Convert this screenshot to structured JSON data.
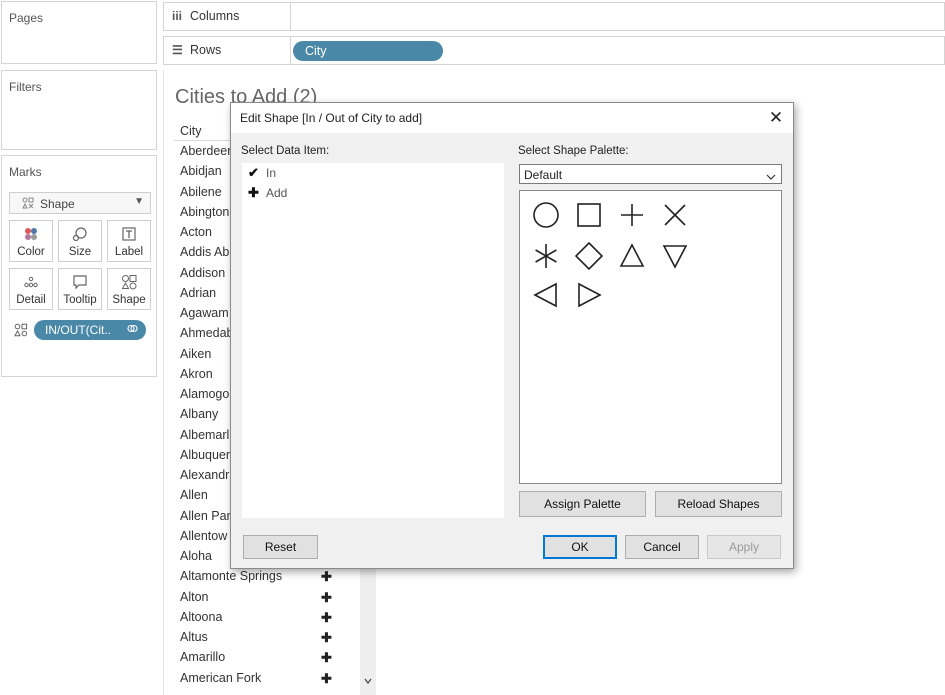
{
  "panes": {
    "pages_title": "Pages",
    "filters_title": "Filters",
    "marks_title": "Marks"
  },
  "marks": {
    "type_label": "Shape",
    "buttons": [
      {
        "label": "Color",
        "icon": "color-dots-icon"
      },
      {
        "label": "Size",
        "icon": "size-icon"
      },
      {
        "label": "Label",
        "icon": "label-icon"
      },
      {
        "label": "Detail",
        "icon": "detail-icon"
      },
      {
        "label": "Tooltip",
        "icon": "tooltip-icon"
      },
      {
        "label": "Shape",
        "icon": "shape-icon"
      }
    ],
    "shape_pill": "IN/OUT(Cit.."
  },
  "shelves": {
    "columns_label": "Columns",
    "rows_label": "Rows",
    "rows_pill": "City"
  },
  "sheet": {
    "title": "Cities to Add (2)",
    "column_header": "City",
    "cities": [
      {
        "name": "Aberdeen",
        "mark": ""
      },
      {
        "name": "Abidjan",
        "mark": ""
      },
      {
        "name": "Abilene",
        "mark": ""
      },
      {
        "name": "Abington",
        "mark": ""
      },
      {
        "name": "Acton",
        "mark": ""
      },
      {
        "name": "Addis Ab",
        "mark": ""
      },
      {
        "name": "Addison",
        "mark": ""
      },
      {
        "name": "Adrian",
        "mark": ""
      },
      {
        "name": "Agawam",
        "mark": ""
      },
      {
        "name": "Ahmedab",
        "mark": ""
      },
      {
        "name": "Aiken",
        "mark": ""
      },
      {
        "name": "Akron",
        "mark": ""
      },
      {
        "name": "Alamogo",
        "mark": ""
      },
      {
        "name": "Albany",
        "mark": ""
      },
      {
        "name": "Albemarl",
        "mark": ""
      },
      {
        "name": "Albuquer",
        "mark": ""
      },
      {
        "name": "Alexandr",
        "mark": ""
      },
      {
        "name": "Allen",
        "mark": ""
      },
      {
        "name": "Allen Par",
        "mark": ""
      },
      {
        "name": "Allentow",
        "mark": ""
      },
      {
        "name": "Aloha",
        "mark": ""
      },
      {
        "name": "Altamonte Springs",
        "mark": "✚"
      },
      {
        "name": "Alton",
        "mark": "✚"
      },
      {
        "name": "Altoona",
        "mark": "✚"
      },
      {
        "name": "Altus",
        "mark": "✚"
      },
      {
        "name": "Amarillo",
        "mark": "✚"
      },
      {
        "name": "American Fork",
        "mark": "✚"
      }
    ]
  },
  "dialog": {
    "title": "Edit Shape [In / Out of City to add]",
    "select_data_item_label": "Select Data Item:",
    "data_items": [
      {
        "label": "In",
        "mark": "✔"
      },
      {
        "label": "Add",
        "mark": "✚"
      }
    ],
    "select_palette_label": "Select Shape Palette:",
    "palette_value": "Default",
    "shapes": [
      "circle-shape",
      "square-shape",
      "plus-shape",
      "cross-shape",
      "asterisk-shape",
      "diamond-shape",
      "triangle-up-shape",
      "triangle-down-shape",
      "triangle-left-shape",
      "triangle-right-shape"
    ],
    "assign_label": "Assign Palette",
    "reload_label": "Reload Shapes",
    "reset_label": "Reset",
    "ok_label": "OK",
    "cancel_label": "Cancel",
    "apply_label": "Apply"
  },
  "colors": {
    "pill_blue": "#4a88a8",
    "ok_focus": "#0078d7"
  }
}
